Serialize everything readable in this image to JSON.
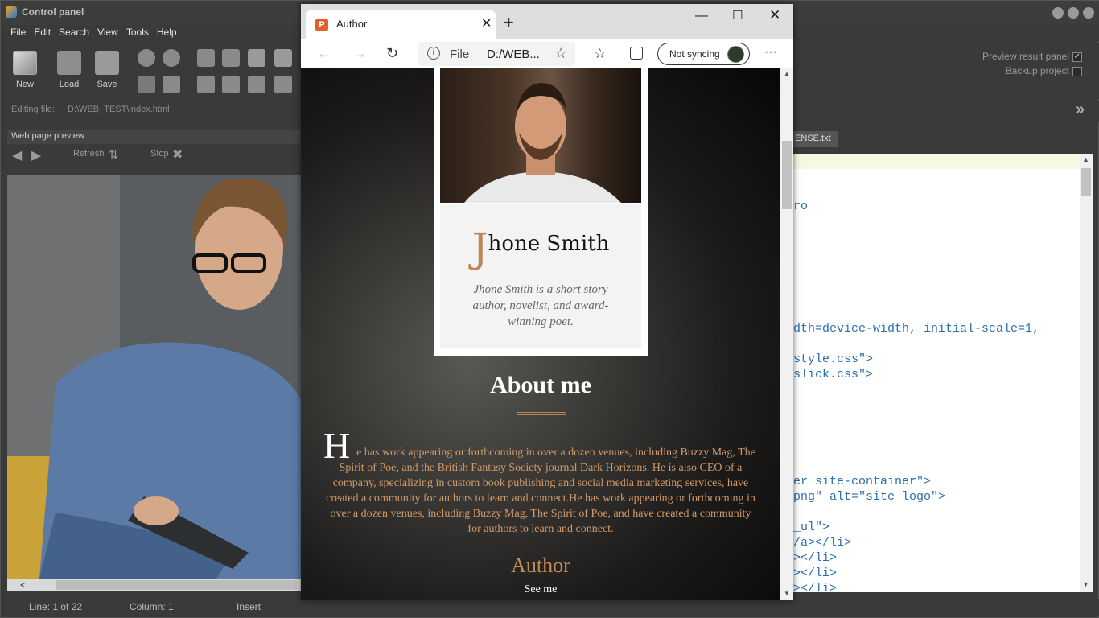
{
  "app": {
    "title": "Control panel",
    "menu": [
      "File",
      "Edit",
      "Search",
      "View",
      "Tools",
      "Help"
    ],
    "toolbar": {
      "new": "New",
      "load": "Load",
      "save": "Save"
    },
    "editing_label": "Editing file:",
    "editing_path": "D:\\WEB_TEST\\index.html",
    "preview": {
      "header": "Web page preview",
      "refresh": "Refresh",
      "stop": "Stop"
    },
    "options": {
      "preview_result": "Preview result panel",
      "backup": "Backup project"
    },
    "tab_fragment": "ENSE.txt",
    "status": {
      "line": "Line: 1 of 22",
      "column": "Column: 1",
      "mode": "Insert"
    },
    "code_lines": [
      {
        "t": "ro",
        "c": "#2a6fb0"
      },
      {
        "t": "dth=device-width, initial-scale=1,",
        "c": "#2a6fb0"
      },
      {
        "t": "style.css\">",
        "c": "#2a6fb0"
      },
      {
        "t": "slick.css\">",
        "c": "#2a6fb0"
      },
      {
        "t": "er site-container\">",
        "c": "#2a6fb0"
      },
      {
        "t": "png\" alt=\"site logo\">",
        "c": "#2a6fb0"
      },
      {
        "t": "_ul\">",
        "c": "#2a6fb0"
      },
      {
        "t": "/a></li>",
        "c": "#2a6fb0"
      },
      {
        "t": "></li>",
        "c": "#2a6fb0"
      },
      {
        "t": "></li>",
        "c": "#2a6fb0"
      },
      {
        "t": "></li>",
        "c": "#2a6fb0"
      }
    ]
  },
  "browser": {
    "tab_title": "Author",
    "favicon": "P",
    "url_scheme": "File",
    "url_path": "D:/WEB...",
    "sync": "Not syncing",
    "page": {
      "name_initial": "J",
      "name_rest": "hone Smith",
      "bio": "Jhone Smith is a short story author, novelist, and award-winning poet.",
      "about_title": "About me",
      "about_initial": "H",
      "about_text": "e has work appearing or forthcoming in over a dozen venues, including Buzzy Mag, The Spirit of Poe, and the British Fantasy Society journal Dark Horizons. He is also CEO of a company, specializing in custom book publishing and social media marketing services, have created a community for authors to learn and connect.He has work appearing or forthcoming in over a dozen venues, including Buzzy Mag, The Spirit of Poe, and have created a community for authors to learn and connect.",
      "author_heading": "Author",
      "see_me": "See me"
    }
  },
  "colors": {
    "accent": "#b9875a",
    "about_text": "#d29a68"
  }
}
